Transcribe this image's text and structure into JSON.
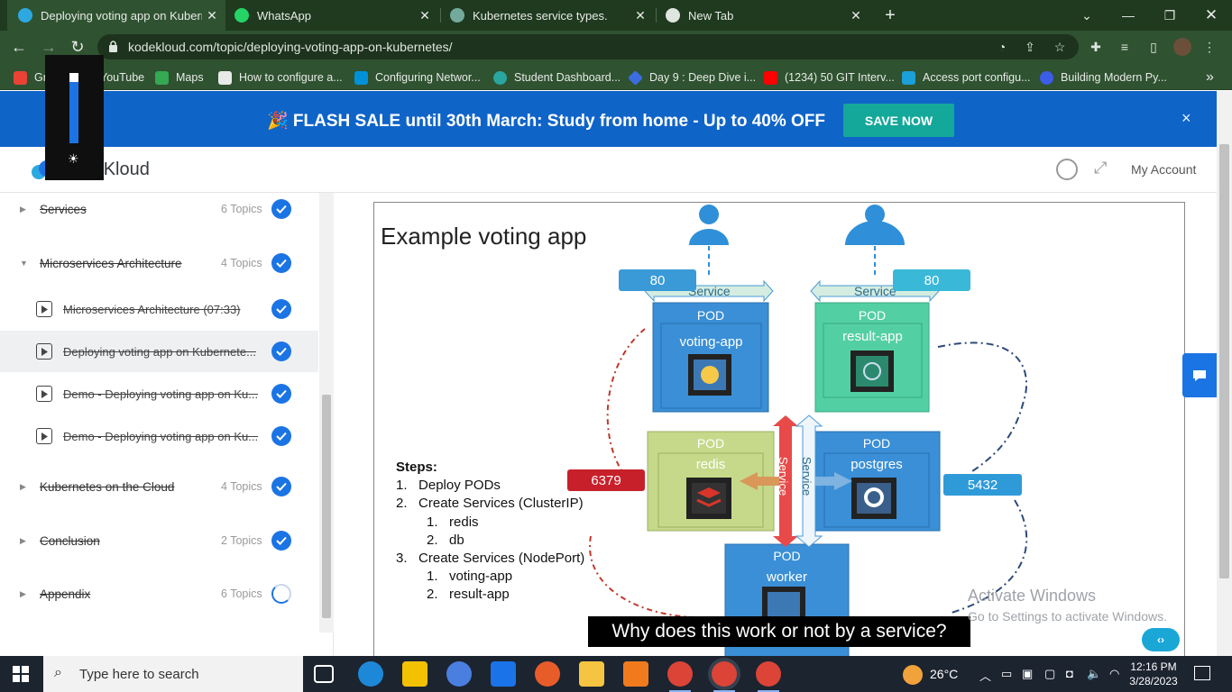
{
  "browser": {
    "tabs": [
      {
        "title": "Deploying voting app on Kubernetes",
        "active": true,
        "favicon": "kodekloud-icon"
      },
      {
        "title": "WhatsApp",
        "active": false,
        "favicon": "whatsapp-icon"
      },
      {
        "title": "Kubernetes service types.",
        "active": false,
        "favicon": "chatgpt-icon"
      },
      {
        "title": "New Tab",
        "active": false,
        "favicon": "chrome-icon"
      }
    ],
    "new_tab": "+",
    "url": "kodekloud.com/topic/deploying-voting-app-on-kubernetes/",
    "bookmarks": [
      {
        "label": "Gmail",
        "icon": "gmail-icon"
      },
      {
        "label": "YouTube",
        "icon": "youtube-icon"
      },
      {
        "label": "Maps",
        "icon": "maps-icon"
      },
      {
        "label": "How to configure a...",
        "icon": "page-icon"
      },
      {
        "label": "Configuring Networ...",
        "icon": "vmware-icon"
      },
      {
        "label": "Student Dashboard...",
        "icon": "cloud-icon"
      },
      {
        "label": "Day 9 : Deep Dive i...",
        "icon": "diamond-icon"
      },
      {
        "label": "(1234) 50 GIT Interv...",
        "icon": "youtube-icon"
      },
      {
        "label": "Access port configu...",
        "icon": "cisco-icon"
      },
      {
        "label": "Building Modern Py...",
        "icon": "c-icon"
      }
    ],
    "more_bookmarks": "»"
  },
  "promo": {
    "text": "🎉 FLASH SALE until 30th March: Study from home - Up to 40% OFF",
    "cta": "SAVE NOW",
    "close": "×"
  },
  "header": {
    "logo": "KodeKloud",
    "account": "My Account"
  },
  "sidebar": {
    "items": [
      {
        "label": "Services",
        "count": "6 Topics",
        "expanded": false,
        "status": "complete"
      },
      {
        "label": "Microservices Architecture",
        "count": "4 Topics",
        "expanded": true,
        "status": "complete"
      },
      {
        "label": "Microservices Architecture (07:33)",
        "status": "complete",
        "lesson": true
      },
      {
        "label": "Deploying voting app on Kubernete...",
        "status": "complete",
        "lesson": true,
        "selected": true
      },
      {
        "label": "Demo - Deploying voting app on Ku...",
        "status": "complete",
        "lesson": true
      },
      {
        "label": "Demo - Deploying voting app on Ku...",
        "status": "complete",
        "lesson": true
      },
      {
        "label": "Kubernetes on the Cloud",
        "count": "4 Topics",
        "expanded": false,
        "status": "complete"
      },
      {
        "label": "Conclusion",
        "count": "2 Topics",
        "expanded": false,
        "status": "complete"
      },
      {
        "label": "Appendix",
        "count": "6 Topics",
        "expanded": false,
        "status": "in-progress"
      }
    ]
  },
  "slide": {
    "title": "Example voting app",
    "steps_heading": "Steps:",
    "steps": [
      {
        "n": "1.",
        "text": "Deploy PODs",
        "level": 1
      },
      {
        "n": "2.",
        "text": "Create Services (ClusterIP)",
        "level": 1
      },
      {
        "n": "1.",
        "text": "redis",
        "level": 2
      },
      {
        "n": "2.",
        "text": "db",
        "level": 2
      },
      {
        "n": "3.",
        "text": "Create Services (NodePort)",
        "level": 1
      },
      {
        "n": "1.",
        "text": "voting-app",
        "level": 2
      },
      {
        "n": "2.",
        "text": "result-app",
        "level": 2
      }
    ],
    "pods": [
      {
        "label": "POD",
        "name": "voting-app"
      },
      {
        "label": "POD",
        "name": "result-app"
      },
      {
        "label": "POD",
        "name": "redis"
      },
      {
        "label": "POD",
        "name": "postgres"
      },
      {
        "label": "POD",
        "name": "worker"
      }
    ],
    "services": [
      "Service",
      "Service",
      "Service",
      "Service"
    ],
    "ports": [
      "80",
      "80",
      "6379",
      "5432"
    ]
  },
  "caption": "Why does this work or not by a service?",
  "watermark": {
    "line1": "Activate Windows",
    "line2": "Go to Settings to activate Windows."
  },
  "taskbar": {
    "search_placeholder": "Type here to search",
    "weather": "26°C",
    "time": "12:16 PM",
    "date": "3/28/2023"
  },
  "colors": {
    "promo_bg": "#0f64c8",
    "cta_bg": "#14a89a",
    "check": "#1b74e4",
    "tab_bar": "#1f3a1f",
    "toolbar": "#2f5230"
  }
}
